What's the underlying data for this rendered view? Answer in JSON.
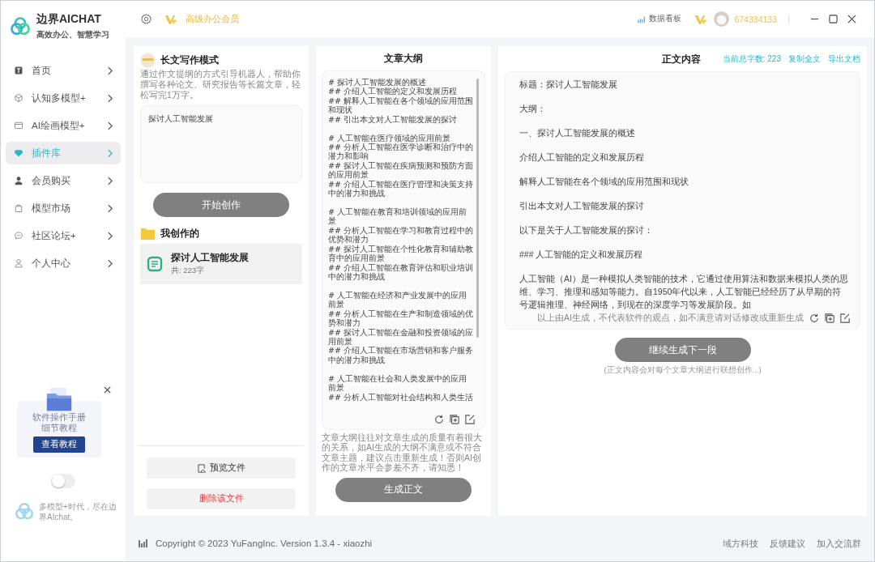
{
  "app": {
    "name": "边界AICHAT",
    "tagline": "高效办公、智慧学习"
  },
  "header": {
    "vip_label": "高级办公会员",
    "dashboard": "数据看板",
    "user_id": "674334133"
  },
  "sidebar": {
    "items": [
      {
        "label": "首页",
        "kind": "home",
        "selected": false
      },
      {
        "label": "认知多模型+",
        "kind": "cube",
        "selected": false
      },
      {
        "label": "AI绘画模型+",
        "kind": "window",
        "selected": false
      },
      {
        "label": "插件库",
        "kind": "gem",
        "selected": true
      },
      {
        "label": "会员购买",
        "kind": "member",
        "selected": false
      },
      {
        "label": "模型市场",
        "kind": "bag",
        "selected": false
      },
      {
        "label": "社区论坛+",
        "kind": "chat",
        "selected": false
      },
      {
        "label": "个人中心",
        "kind": "profile",
        "selected": false
      }
    ],
    "promo": {
      "line1": "软件操作手册",
      "line2": "细节教程",
      "button": "查看教程"
    },
    "theme_toggle": {
      "on": false
    },
    "slogan": "多模型+时代，尽在边界AIchat。"
  },
  "writer": {
    "title": "长文写作模式",
    "description": "通过作文提纲的方式引导机器人，帮助你撰写各种论文、研究报告等长篇文章，轻松写完1万字。",
    "topic": "探讨人工智能发展",
    "start_button": "开始创作",
    "my_works_title": "我创作的",
    "works": [
      {
        "title": "探讨人工智能发展",
        "count": "共: 223字",
        "selected": true
      }
    ],
    "preview_button": "预览文件",
    "delete_button": "删除该文件"
  },
  "outline": {
    "title": "文章大纲",
    "sections": [
      [
        "# 探讨人工智能发展的概述",
        "## 介绍人工智能的定义和发展历程",
        "## 解释人工智能在各个领域的应用范围和现状",
        "## 引出本文对人工智能发展的探讨"
      ],
      [
        "# 人工智能在医疗领域的应用前景",
        "## 分析人工智能在医学诊断和治疗中的潜力和影响",
        "## 探讨人工智能在疾病预测和预防方面的应用前景",
        "## 介绍人工智能在医疗管理和决策支持中的潜力和挑战"
      ],
      [
        "# 人工智能在教育和培训领域的应用前景",
        "## 分析人工智能在学习和教育过程中的优势和潜力",
        "## 探讨人工智能在个性化教育和辅助教育中的应用前景",
        "## 介绍人工智能在教育评估和职业培训中的潜力和挑战"
      ],
      [
        "# 人工智能在经济和产业发展中的应用前景",
        "## 分析人工智能在生产和制造领域的优势和潜力",
        "## 探讨人工智能在金融和投资领域的应用前景",
        "## 介绍人工智能在市场营销和客户服务中的潜力和挑战"
      ],
      [
        "# 人工智能在社会和人类发展中的应用前景",
        "## 分析人工智能对社会结构和人类生活"
      ]
    ],
    "note": "文章大纲往往对文章生成的质量有着很大的关系，如AI生成的大纲不满意或不符合文章主题，建议点击重新生成！否则AI创作的文章水平会参差不齐，请知悉！",
    "generate_button": "生成正文"
  },
  "content": {
    "title": "正文内容",
    "word_count": "当前总字数: 223",
    "copy_link": "复制全文",
    "export_link": "导出文档",
    "paragraphs": [
      "标题：探讨人工智能发展",
      "大纲：",
      "一、探讨人工智能发展的概述",
      "介绍人工智能的定义和发展历程",
      "解释人工智能在各个领域的应用范围和现状",
      "引出本文对人工智能发展的探讨",
      "以下是关于人工智能发展的探讨：",
      "### 人工智能的定义和发展历程",
      "人工智能（AI）是一种模拟人类智能的技术，它通过使用算法和数据来模拟人类的思维、学习、推理和感知等能力。自1950年代以来，人工智能已经经历了从早期的符号逻辑推理、神经网络，到现在的深度学习等发展阶段。如"
    ],
    "disclaimer": "以上由AI生成，不代表软件的观点，如不满意请对话修改或重新生成",
    "continue_button": "继续生成下一段",
    "continue_hint": "(正文内容会对每个文章大纲进行联想创作...)"
  },
  "footer": {
    "copyright": "Copyright © 2023 YuFangInc. Version 1.3.4 - xiaozhi",
    "links": [
      "域方科技",
      "反馈建议",
      "加入交流群"
    ]
  }
}
